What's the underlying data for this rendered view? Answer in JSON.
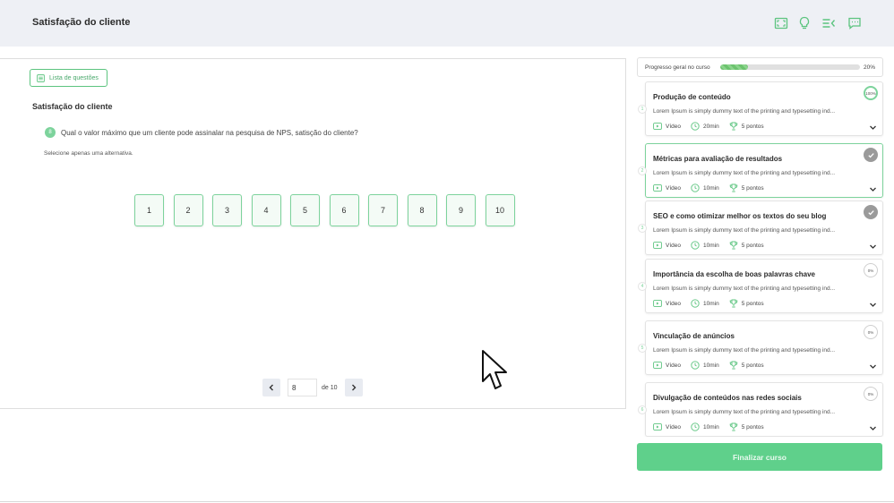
{
  "header": {
    "title": "Satisfação do cliente"
  },
  "question_panel": {
    "list_button": "Lista de questões",
    "section_title": "Satisfação do cliente",
    "question_number": "8",
    "question_text": "Qual o valor máximo que um cliente pode assinalar na pesquisa de NPS, satisção do cliente?",
    "hint": "Selecione apenas uma alternativa.",
    "options": [
      "1",
      "2",
      "3",
      "4",
      "5",
      "6",
      "7",
      "8",
      "9",
      "10"
    ]
  },
  "pager": {
    "current": "8",
    "of_label": "de 10"
  },
  "course_progress": {
    "label": "Progresso geral no curso",
    "percent_label": "20%",
    "value": 0.2
  },
  "modules": [
    {
      "num": "1",
      "title": "Produção de conteúdo",
      "desc": "Lorem Ipsum is simply dummy text of the printing and typesetting ind...",
      "type": "Vídeo",
      "duration": "20min",
      "points": "5 pontos",
      "status": "100%"
    },
    {
      "num": "2",
      "title": "Métricas para avaliação de resultados",
      "desc": "Lorem Ipsum is simply dummy text of the printing and typesetting ind...",
      "type": "Vídeo",
      "duration": "10min",
      "points": "5 pontos",
      "status": "done"
    },
    {
      "num": "3",
      "title": "SEO e como otimizar melhor os textos do seu blog",
      "desc": "Lorem Ipsum is simply dummy text of the printing and typesetting ind...",
      "type": "Vídeo",
      "duration": "10min",
      "points": "5 pontos",
      "status": "done"
    },
    {
      "num": "4",
      "title": "Importância da escolha de boas palavras chave",
      "desc": "Lorem Ipsum is simply dummy text of the printing and typesetting ind...",
      "type": "Vídeo",
      "duration": "10min",
      "points": "5 pontos",
      "status": "0%"
    },
    {
      "num": "5",
      "title": "Vinculação de anúncios",
      "desc": "Lorem Ipsum is simply dummy text of the printing and typesetting ind...",
      "type": "Vídeo",
      "duration": "10min",
      "points": "5 pontos",
      "status": "0%"
    },
    {
      "num": "6",
      "title": "Divulgação de conteúdos nas redes sociais",
      "desc": "Lorem Ipsum is simply dummy text of the printing and typesetting ind...",
      "type": "Vídeo",
      "duration": "10min",
      "points": "5 pontos",
      "status": "0%"
    }
  ],
  "finish_button": "Finalizar curso",
  "colors": {
    "accent": "#5fd08b",
    "accent_light": "#7dd39c",
    "header_bg": "#eef0f5"
  },
  "icons": [
    "expand-icon",
    "lightbulb-icon",
    "list-collapse-icon",
    "chat-icon",
    "list-icon",
    "chevron-left-icon",
    "chevron-right-icon",
    "video-icon",
    "clock-icon",
    "trophy-icon",
    "chevron-down-icon",
    "check-icon"
  ]
}
